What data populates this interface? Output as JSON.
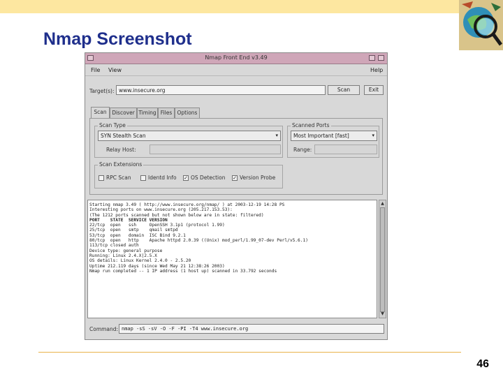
{
  "slide": {
    "title": "Nmap Screenshot",
    "page_number": "46",
    "colors": {
      "top_band": "#fde7a0",
      "title": "#1f2f8c",
      "rule": "#e8b24a"
    },
    "logo_icon": "magnifying-glass-globe-logo"
  },
  "window": {
    "title": "Nmap Front End v3.49",
    "titlebar_color": "#cfa6b8",
    "menu": {
      "file": "File",
      "view": "View",
      "help": "Help"
    },
    "target_label": "Target(s):",
    "target_value": "www.insecure.org",
    "scan_button": "Scan",
    "exit_button": "Exit",
    "tabs": [
      {
        "label": "Scan",
        "active": true
      },
      {
        "label": "Discover",
        "active": false
      },
      {
        "label": "Timing",
        "active": false
      },
      {
        "label": "Files",
        "active": false
      },
      {
        "label": "Options",
        "active": false
      }
    ],
    "scan_type": {
      "title": "Scan Type",
      "selected": "SYN Stealth Scan",
      "relay_host_label": "Relay Host:",
      "relay_host_value": ""
    },
    "scanned_ports": {
      "title": "Scanned Ports",
      "selected": "Most Important [fast]",
      "range_label": "Range:",
      "range_value": ""
    },
    "scan_extensions": {
      "title": "Scan Extensions",
      "items": [
        {
          "label": "RPC Scan",
          "checked": false
        },
        {
          "label": "Identd Info",
          "checked": false
        },
        {
          "label": "OS Detection",
          "checked": true
        },
        {
          "label": "Version Probe",
          "checked": true
        }
      ]
    },
    "output_lines": [
      {
        "text": "Starting nmap 3.49 ( http://www.insecure.org/nmap/ ) at 2003-12-19 14:28 PS",
        "color": "#222222"
      },
      {
        "text": "Interesting ports on www.insecure.org (205.217.153.53):",
        "color": "#222222"
      },
      {
        "text": "(The 1212 ports scanned but not shown below are in state: filtered)",
        "color": "#222222"
      },
      {
        "text": "PORT    STATE  SERVICE VERSION",
        "color": "#222222",
        "bold": true
      },
      {
        "text": "22/tcp  open   ssh     OpenSSH 3.1p1 (protocol 1.99)",
        "color": "#222222",
        "mark": "ssh"
      },
      {
        "text": "25/tcp  open   smtp    qmail smtpd",
        "color": "#222222",
        "mark": "smtp"
      },
      {
        "text": "53/tcp  open   domain  ISC Bind 9.2.1",
        "color": "#222222"
      },
      {
        "text": "80/tcp  open   http    Apache httpd 2.0.39 ((Unix) mod_perl/1.99_07-dev Perl/v5.6.1)",
        "color": "#222222"
      },
      {
        "text": "113/tcp closed auth",
        "color": "#222222"
      },
      {
        "text": "Device type: general purpose",
        "color": "#222222"
      },
      {
        "text": "Running: Linux 2.4.X|2.5.X",
        "color": "#222222",
        "mark": "Linux"
      },
      {
        "text": "OS details: Linux Kernel 2.4.0 - 2.5.20",
        "color": "#222222",
        "mark": "Linux"
      },
      {
        "text": "Uptime 212.119 days (since Wed May 21 12:38:26 2003)",
        "color": "#222222"
      },
      {
        "text": "",
        "color": "#222222"
      },
      {
        "text": "Nmap run completed -- 1 IP address (1 host up) scanned in 33.792 seconds",
        "color": "#222222"
      }
    ],
    "command_label": "Command:",
    "command_value": "nmap -sS -sV -O -F -PI -T4 www.insecure.org"
  }
}
